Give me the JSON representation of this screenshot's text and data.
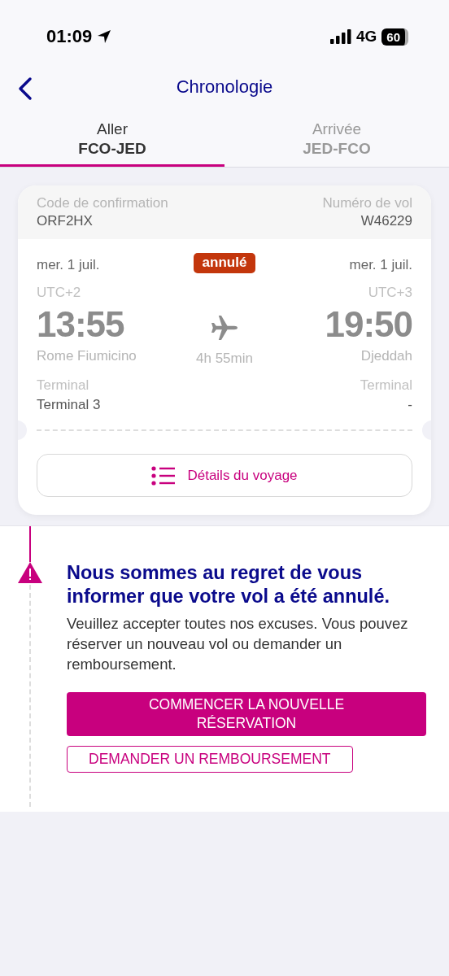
{
  "status_bar": {
    "time": "01:09",
    "network": "4G",
    "battery": "60"
  },
  "header": {
    "title": "Chronologie"
  },
  "tabs": [
    {
      "label": "Aller",
      "route": "FCO-JED",
      "selected": true
    },
    {
      "label": "Arrivée",
      "route": "JED-FCO",
      "selected": false
    }
  ],
  "booking": {
    "confirmation_label": "Code de confirmation",
    "confirmation_code": "ORF2HX",
    "flight_label": "Numéro de vol",
    "flight_number": "W46229"
  },
  "flight": {
    "status": "annulé",
    "cancelled": true,
    "duration": "4h 55min",
    "departure": {
      "date": "mer. 1 juil.",
      "timezone": "UTC+2",
      "time": "13:55",
      "airport": "Rome Fiumicino",
      "terminal_label": "Terminal",
      "terminal": "Terminal 3"
    },
    "arrival": {
      "date": "mer. 1 juil.",
      "timezone": "UTC+3",
      "time": "19:50",
      "airport": "Djeddah",
      "terminal_label": "Terminal",
      "terminal": "-"
    }
  },
  "details_button": "Détails du voyage",
  "notice": {
    "title": "Nous sommes au regret de vous informer que votre vol a été annulé.",
    "message": "Veuillez accepter toutes nos excuses. Vous pouvez réserver un nouveau vol ou demander un remboursement.",
    "buttons": [
      {
        "label": "COMMENCER LA NOUVELLE RÉSERVATION",
        "kind": "primary"
      },
      {
        "label": "DEMANDER UN REMBOURSEMENT",
        "kind": "secondary"
      }
    ]
  }
}
